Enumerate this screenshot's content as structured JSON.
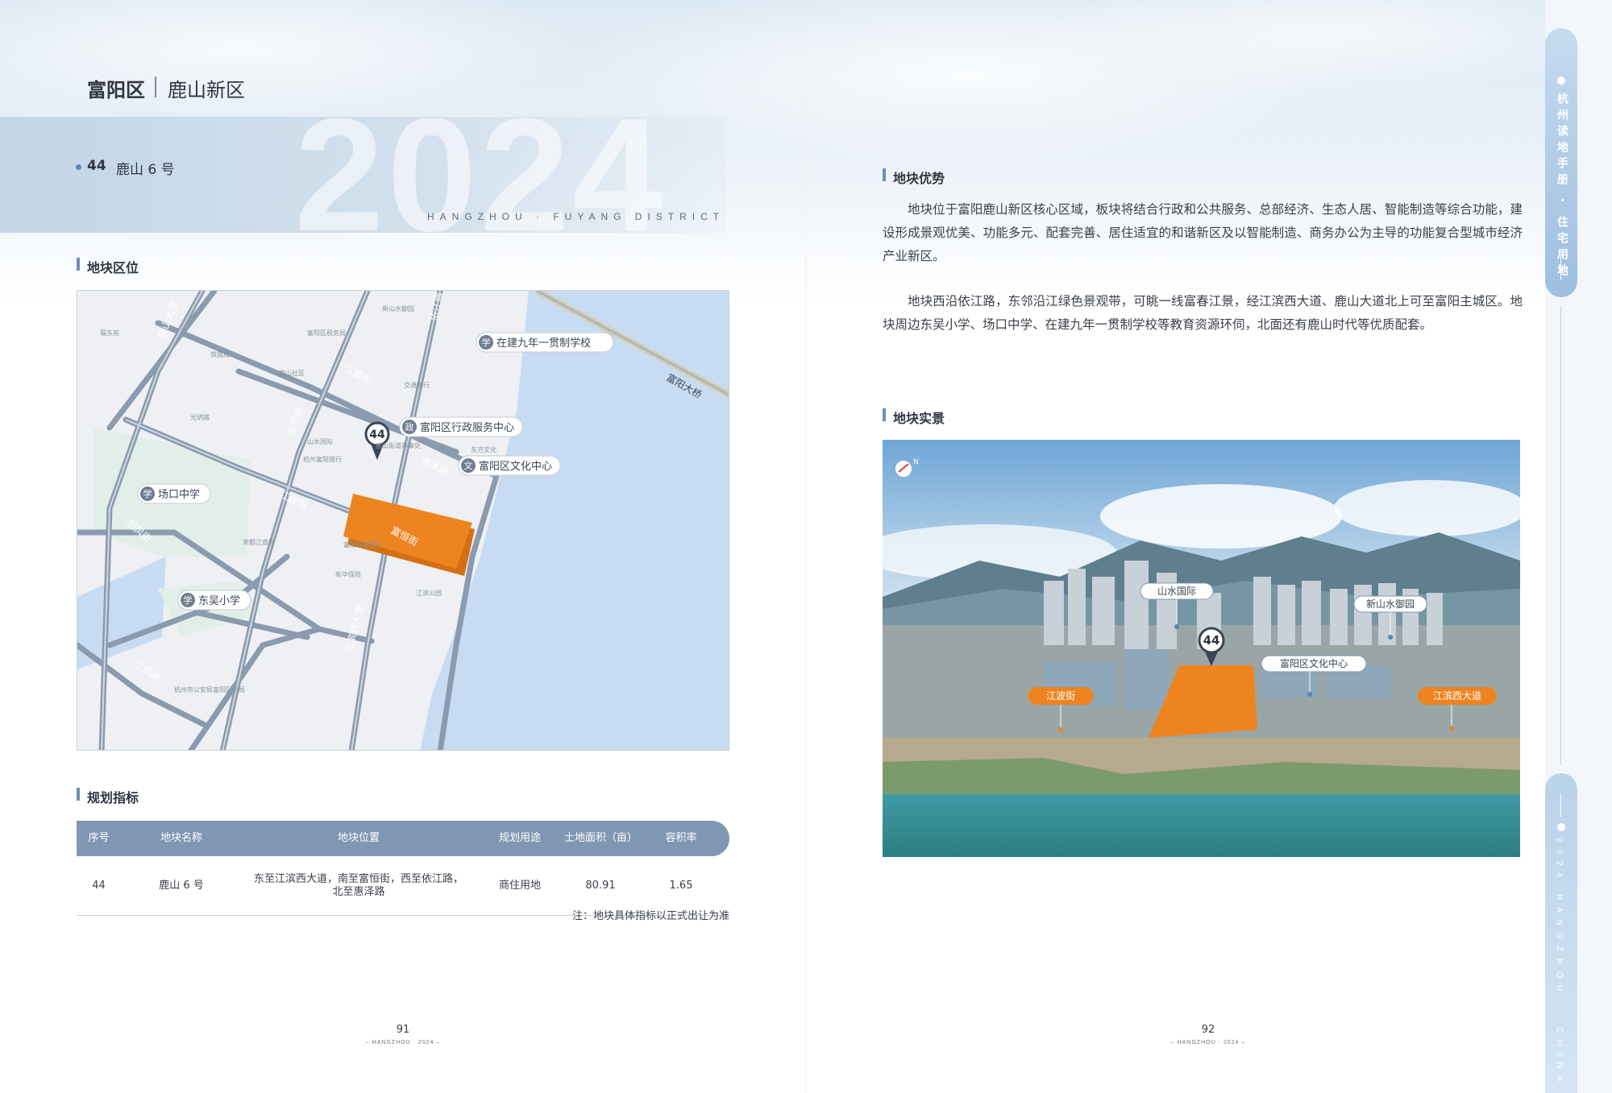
{
  "header": {
    "district": "富阳区",
    "area": "鹿山新区",
    "year_watermark": "2024",
    "district_en": "HANGZHOU · FUYANG DISTRICT"
  },
  "plot": {
    "number": "44",
    "name": "鹿山 6 号"
  },
  "sections": {
    "location": "地块区位",
    "planning": "规划指标",
    "advantages": "地块优势",
    "photo": "地块实景"
  },
  "map": {
    "marker": "44",
    "pois": {
      "school_new": "在建九年一贯制学校",
      "gov_center": "富阳区行政服务中心",
      "culture_center": "富阳区文化中心",
      "changkou_school": "场口中学",
      "donghao_school": "东吴小学"
    },
    "poi_badges": {
      "school": "学",
      "gov": "政",
      "culture": "文"
    },
    "roads": {
      "lushan_rd": "鹿山大道",
      "fuyang_bridge": "富阳大桥",
      "yijiang_rd": "依江路",
      "jiangxia_st": "江夏街",
      "longhua_rd": "龙华路",
      "huize_rd": "惠泽路",
      "jiangbo_st": "江波街",
      "fuheng_st": "富恒街",
      "yangfeng_st": "阳风街",
      "jiangbin_west": "江滨西大道",
      "jiangfeng_rd": "江枫路"
    },
    "small_labels": {
      "xinshan": "新山水御园",
      "fuyang_tax": "富阳区税务局",
      "tiezhu": "铁路局",
      "lushan_cun": "鹿山社区",
      "guangming": "光明路",
      "shanshui": "山水国际",
      "hangzhou_bank": "杭州富阳银行",
      "jiaotong": "交通银行",
      "lushan_office": "鹿山街道办事处",
      "dongfang": "东方文化",
      "police": "杭州市公安局富阳区分局",
      "xinhua": "新华保险",
      "songjiang": "宋都江南府",
      "fuyang_nc": "富阳农商银行",
      "jiangbin_garden": "江滨公园",
      "xiaofu": "福东苑"
    }
  },
  "table": {
    "headers": [
      "序号",
      "地块名称",
      "地块位置",
      "规划用途",
      "土地面积（亩）",
      "容积率"
    ],
    "rows": [
      [
        "44",
        "鹿山 6 号",
        "东至江滨西大道，南至富恒街，西至依江路，北至惠泽路",
        "商住用地",
        "80.91",
        "1.65"
      ]
    ],
    "note": "注：地块具体指标以正式出让为准"
  },
  "advantages": {
    "p1": "地块位于富阳鹿山新区核心区域，板块将结合行政和公共服务、总部经济、生态人居、智能制造等综合功能，建设形成景观优美、功能多元、配套完善、居住适宜的和谐新区及以智能制造、商务办公为主导的功能复合型城市经济产业新区。",
    "p2": "地块西沿依江路，东邻沿江绿色景观带，可眺一线富春江景，经江滨西大道、鹿山大道北上可至富阳主城区。地块周边东吴小学、场口中学、在建九年一贯制学校等教育资源环伺，北面还有鹿山时代等优质配套。"
  },
  "photo": {
    "marker": "44",
    "labels": {
      "shanshui": "山水国际",
      "xinshan": "新山水御园",
      "culture": "富阳区文化中心",
      "jiangbo": "江波街",
      "jiangbin": "江滨西大道"
    },
    "compass": "N"
  },
  "footer": {
    "left_page": "91",
    "right_page": "92",
    "left_sub": "– HANGZHOU · 2024 –",
    "right_sub": "– HANGZHOU · 2024 –"
  },
  "rail": {
    "top_text": "杭州读地手册 · 住宅用地",
    "bottom_text": "2024 HANGZHOU · CHINA"
  },
  "colors": {
    "accent": "#7f97b3",
    "plot_orange": "#ee8420",
    "road": "#8a9bb0"
  }
}
